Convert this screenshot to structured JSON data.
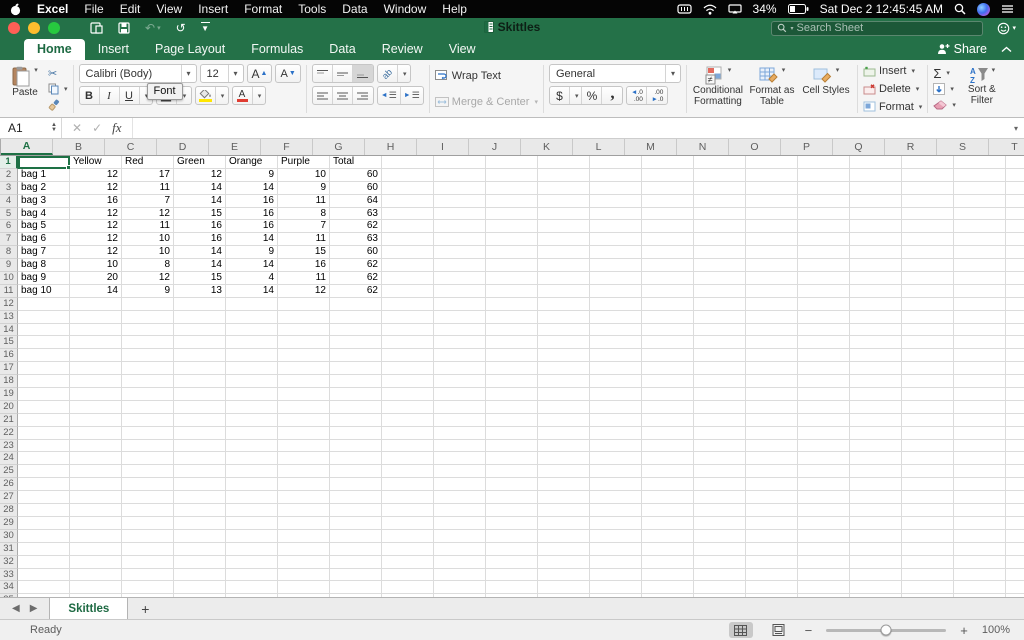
{
  "app": {
    "name": "Excel"
  },
  "menubar": {
    "items": [
      "File",
      "Edit",
      "View",
      "Insert",
      "Format",
      "Tools",
      "Data",
      "Window",
      "Help"
    ],
    "battery_percent": "34%",
    "clock": "Sat Dec 2 12:45:45 AM"
  },
  "titlebar": {
    "document_title": "Skittles",
    "search_placeholder": "Search Sheet"
  },
  "ribbon_tabs": {
    "items": [
      "Home",
      "Insert",
      "Page Layout",
      "Formulas",
      "Data",
      "Review",
      "View"
    ],
    "active": "Home"
  },
  "share": {
    "label": "Share"
  },
  "ribbon": {
    "paste": "Paste",
    "font_name": "Calibri (Body)",
    "font_size": "12",
    "bold": "B",
    "italic": "I",
    "underline": "U",
    "font_tooltip": "Font",
    "wrap_text": "Wrap Text",
    "merge_center": "Merge & Center",
    "number_format": "General",
    "currency": "$",
    "percent": "%",
    "comma": ",",
    "inc_decimal_top": "◄.0",
    "inc_decimal_bottom": ".00",
    "dec_decimal_top": ".00",
    "dec_decimal_bottom": "►.0",
    "conditional_formatting": "Conditional Formatting",
    "format_as_table": "Format as Table",
    "cell_styles": "Cell Styles",
    "insert": "Insert",
    "delete": "Delete",
    "format": "Format",
    "autosum": "Σ",
    "sort_filter": "Sort & Filter"
  },
  "formula_bar": {
    "name_box": "A1",
    "fx_label": "fx",
    "value": ""
  },
  "spreadsheet": {
    "columns": [
      "A",
      "B",
      "C",
      "D",
      "E",
      "F",
      "G",
      "H",
      "I",
      "J",
      "K",
      "L",
      "M",
      "N",
      "O",
      "P",
      "Q",
      "R",
      "S",
      "T"
    ],
    "row_count": 35,
    "selected_cell": "A1",
    "header_row": [
      "Yellow",
      "Red",
      "Green",
      "Orange",
      "Purple",
      "Total"
    ],
    "rows": [
      {
        "label": "bag 1",
        "values": [
          12,
          17,
          12,
          9,
          10,
          60
        ]
      },
      {
        "label": "bag 2",
        "values": [
          12,
          11,
          14,
          14,
          9,
          60
        ]
      },
      {
        "label": "bag 3",
        "values": [
          16,
          7,
          14,
          16,
          11,
          64
        ]
      },
      {
        "label": "bag 4",
        "values": [
          12,
          12,
          15,
          16,
          8,
          63
        ]
      },
      {
        "label": "bag 5",
        "values": [
          12,
          11,
          16,
          16,
          7,
          62
        ]
      },
      {
        "label": "bag 6",
        "values": [
          12,
          10,
          16,
          14,
          11,
          63
        ]
      },
      {
        "label": "bag 7",
        "values": [
          12,
          10,
          14,
          9,
          15,
          60
        ]
      },
      {
        "label": "bag 8",
        "values": [
          10,
          8,
          14,
          14,
          16,
          62
        ]
      },
      {
        "label": "bag 9",
        "values": [
          20,
          12,
          15,
          4,
          11,
          62
        ]
      },
      {
        "label": "bag 10",
        "values": [
          14,
          9,
          13,
          14,
          12,
          62
        ]
      }
    ]
  },
  "sheet_bar": {
    "active_tab": "Skittles",
    "add_label": "+"
  },
  "status_bar": {
    "ready": "Ready",
    "zoom": "100%"
  },
  "colors": {
    "accent_green": "#217346",
    "selection": "#1e7145",
    "fill_yellow": "#ffe600",
    "font_red": "#e03c31"
  }
}
